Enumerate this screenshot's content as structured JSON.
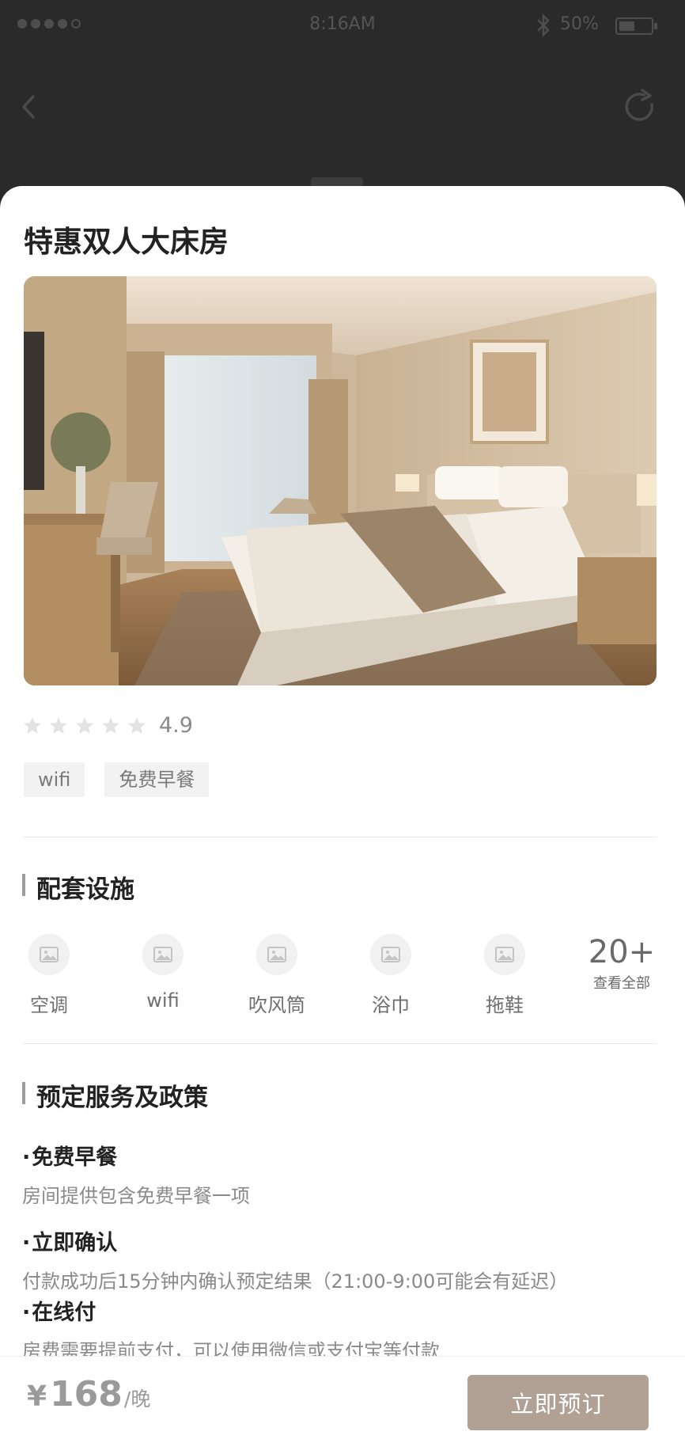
{
  "status_bar": {
    "time": "8:16AM",
    "battery": "50%",
    "battery_level": 0.5
  },
  "room": {
    "title": "特惠双人大床房",
    "photo_alt": "hotel-room-photo",
    "rating": "4.9",
    "stars": 5,
    "tags": [
      "wifi",
      "免费早餐"
    ]
  },
  "facilities": {
    "title": "配套设施",
    "items": [
      {
        "label": "空调",
        "icon": "image-placeholder-icon"
      },
      {
        "label": "wifi",
        "icon": "image-placeholder-icon"
      },
      {
        "label": "吹风筒",
        "icon": "image-placeholder-icon"
      },
      {
        "label": "浴巾",
        "icon": "image-placeholder-icon"
      },
      {
        "label": "拖鞋",
        "icon": "image-placeholder-icon"
      }
    ],
    "more_count": "20+",
    "more_label": "查看全部"
  },
  "policies": {
    "title": "预定服务及政策",
    "items": [
      {
        "name": "免费早餐",
        "desc": "房间提供包含免费早餐一项"
      },
      {
        "name": "立即确认",
        "desc": "付款成功后15分钟内确认预定结果（21:00-9:00可能会有延迟）"
      },
      {
        "name": "在线付",
        "desc": "房费需要提前支付，可以使用微信或支付宝等付款"
      }
    ]
  },
  "booking": {
    "currency": "¥",
    "price": "168",
    "unit": "/晚",
    "button_label": "立即预订",
    "button_color": "#b1a194"
  }
}
